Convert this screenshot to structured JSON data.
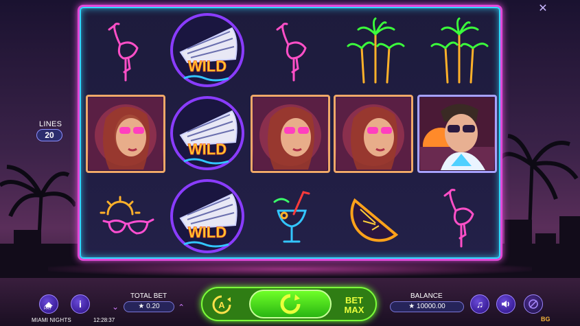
{
  "game": {
    "name": "MIAMI NIGHTS",
    "clock": "12:28:37",
    "logo": "BG"
  },
  "controls": {
    "close_icon": "close-x",
    "lines_label": "LINES",
    "lines_value": "20",
    "pay_label": "PAY",
    "info_label": "i",
    "total_bet_label": "TOTAL BET",
    "total_bet_value": "★ 0.20",
    "bet_max_line1": "BET",
    "bet_max_line2": "MAX",
    "balance_label": "BALANCE",
    "balance_value": "★ 10000.00"
  },
  "reels": {
    "columns": 5,
    "rows": 3,
    "symbols": [
      [
        "flamingo",
        "woman-sunglasses",
        "sunglasses-sun"
      ],
      [
        "wild-ship",
        "wild-ship",
        "wild-ship"
      ],
      [
        "flamingo",
        "woman-sunglasses",
        "cocktail"
      ],
      [
        "palm-trees",
        "woman-sunglasses",
        "orange-slice"
      ],
      [
        "palm-trees",
        "man-sunglasses",
        "flamingo"
      ]
    ],
    "wild_text": "WILD"
  },
  "colors": {
    "frame_pink": "#e24ad9",
    "frame_cyan": "#33d7ff",
    "spin_green": "#6bff2e",
    "accent_purple": "#6a4ad8"
  }
}
